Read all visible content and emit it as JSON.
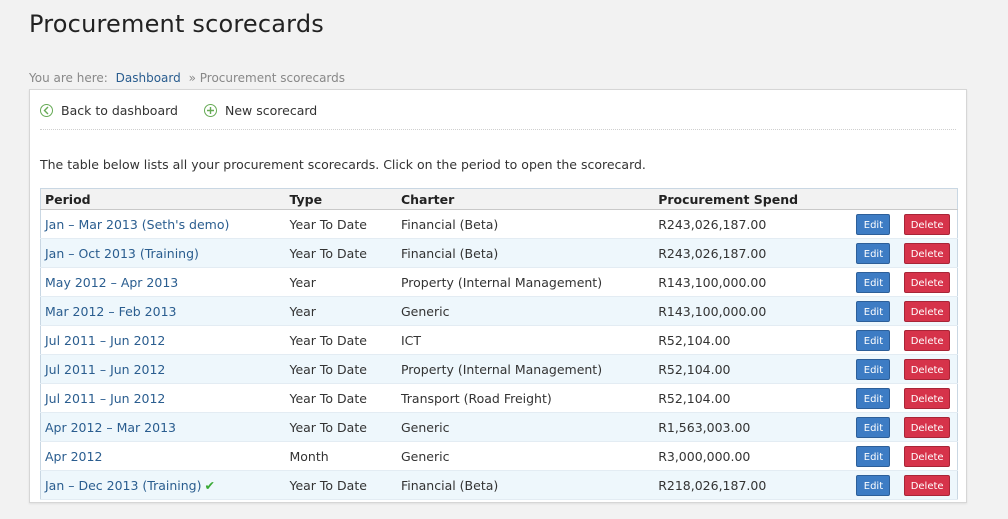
{
  "page": {
    "title": "Procurement scorecards"
  },
  "breadcrumb": {
    "prefix": "You are here:",
    "home": "Dashboard",
    "separator": "»",
    "current": "Procurement scorecards"
  },
  "toolbar": {
    "back_label": "Back to dashboard",
    "new_label": "New scorecard",
    "icon_color": "#66aa55"
  },
  "intro": "The table below lists all your procurement scorecards. Click on the period to open the scorecard.",
  "table": {
    "headers": [
      "Period",
      "Type",
      "Charter",
      "Procurement Spend"
    ],
    "edit_label": "Edit",
    "delete_label": "Delete",
    "rows": [
      {
        "period": "Jan – Mar 2013 (Seth's demo)",
        "type": "Year To Date",
        "charter": "Financial (Beta)",
        "spend": "R243,026,187.00",
        "check": false
      },
      {
        "period": "Jan – Oct 2013 (Training)",
        "type": "Year To Date",
        "charter": "Financial (Beta)",
        "spend": "R243,026,187.00",
        "check": false
      },
      {
        "period": "May 2012 – Apr 2013",
        "type": "Year",
        "charter": "Property (Internal Management)",
        "spend": "R143,100,000.00",
        "check": false
      },
      {
        "period": "Mar 2012 – Feb 2013",
        "type": "Year",
        "charter": "Generic",
        "spend": "R143,100,000.00",
        "check": false
      },
      {
        "period": "Jul 2011 – Jun 2012",
        "type": "Year To Date",
        "charter": "ICT",
        "spend": "R52,104.00",
        "check": false
      },
      {
        "period": "Jul 2011 – Jun 2012",
        "type": "Year To Date",
        "charter": "Property (Internal Management)",
        "spend": "R52,104.00",
        "check": false
      },
      {
        "period": "Jul 2011 – Jun 2012",
        "type": "Year To Date",
        "charter": "Transport (Road Freight)",
        "spend": "R52,104.00",
        "check": false
      },
      {
        "period": "Apr 2012 – Mar 2013",
        "type": "Year To Date",
        "charter": "Generic",
        "spend": "R1,563,003.00",
        "check": false
      },
      {
        "period": "Apr 2012",
        "type": "Month",
        "charter": "Generic",
        "spend": "R3,000,000.00",
        "check": false
      },
      {
        "period": "Jan – Dec 2013 (Training)",
        "type": "Year To Date",
        "charter": "Financial (Beta)",
        "spend": "R218,026,187.00",
        "check": true
      }
    ]
  },
  "colors": {
    "edit_button": "#3d7cc4",
    "delete_button": "#d6334a",
    "link": "#2a5d8f",
    "row_alt": "#eef7fc"
  }
}
